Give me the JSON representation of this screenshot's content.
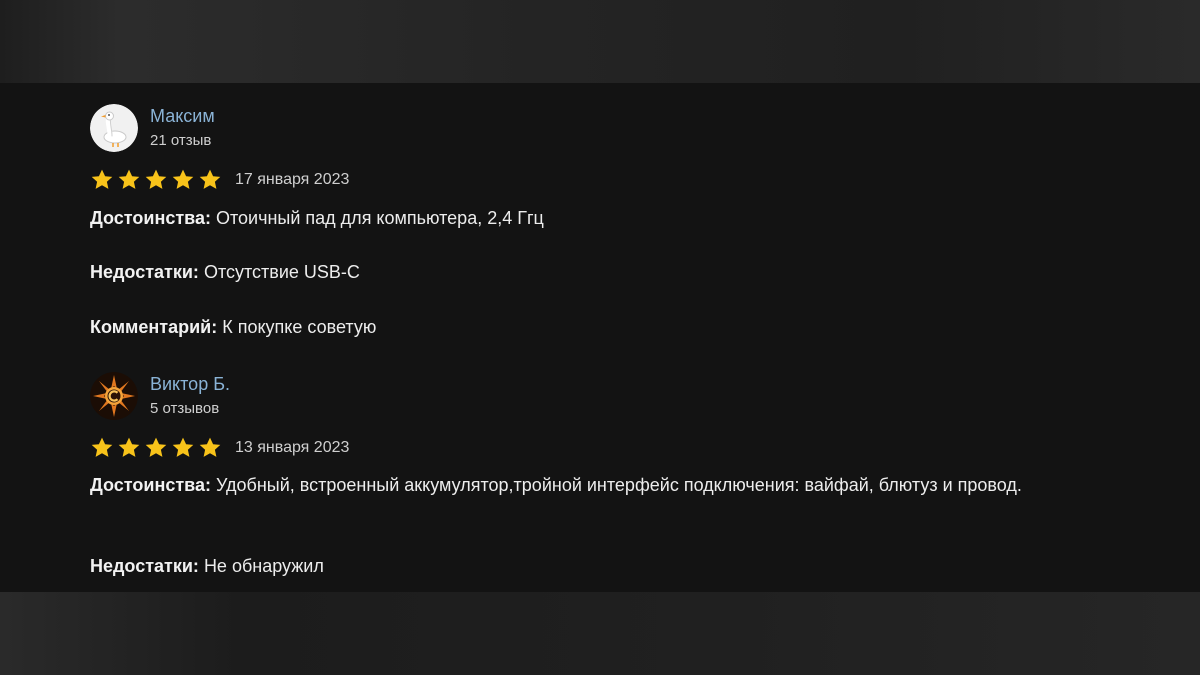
{
  "reviews": [
    {
      "author": "Максим",
      "count": "21 отзыв",
      "rating": 5,
      "date": "17 января 2023",
      "pros_label": "Достоинства:",
      "pros": "Отоичный пад для компьютера, 2,4 Ггц",
      "cons_label": "Недостатки:",
      "cons": "Отсутствие USB-C",
      "comment_label": "Комментарий:",
      "comment": "К покупке советую"
    },
    {
      "author": "Виктор Б.",
      "count": "5 отзывов",
      "rating": 5,
      "date": "13 января 2023",
      "pros_label": "Достоинства:",
      "pros": "Удобный, встроенный аккумулятор,тройной интерфейс подключения: вайфай, блютуз и провод.",
      "cons_label": "Недостатки:",
      "cons": "Не обнаружил"
    }
  ],
  "colors": {
    "panel": "#131313",
    "author": "#8ab3d6",
    "star": "#f8c31a",
    "text": "#ededed"
  },
  "icons": {
    "avatar_1": "goose-avatar-icon",
    "avatar_2": "fire-emblem-avatar-icon",
    "star": "star-icon"
  }
}
